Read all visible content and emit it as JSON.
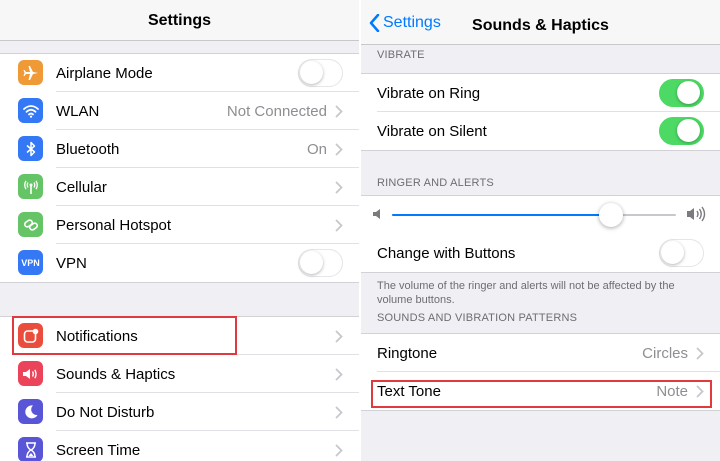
{
  "left": {
    "title": "Settings",
    "group1": [
      {
        "label": "Airplane Mode",
        "icon": "airplane-icon",
        "color": "#f09a37",
        "accessory": "toggle",
        "toggle_on": false
      },
      {
        "label": "WLAN",
        "icon": "wifi-icon",
        "color": "#3478f6",
        "accessory": "value",
        "value": "Not Connected"
      },
      {
        "label": "Bluetooth",
        "icon": "bluetooth-icon",
        "color": "#3478f6",
        "accessory": "value",
        "value": "On"
      },
      {
        "label": "Cellular",
        "icon": "cellular-icon",
        "color": "#65c466",
        "accessory": "chevron"
      },
      {
        "label": "Personal Hotspot",
        "icon": "hotspot-icon",
        "color": "#65c466",
        "accessory": "chevron"
      },
      {
        "label": "VPN",
        "icon": "vpn-icon",
        "icon_text": "VPN",
        "color": "#3478f6",
        "accessory": "toggle",
        "toggle_on": false
      }
    ],
    "group2": [
      {
        "label": "Notifications",
        "icon": "notifications-icon",
        "color": "#eb4d3d",
        "accessory": "chevron"
      },
      {
        "label": "Sounds & Haptics",
        "icon": "speaker-icon",
        "color": "#eb445a",
        "accessory": "chevron"
      },
      {
        "label": "Do Not Disturb",
        "icon": "moon-icon",
        "color": "#5856d6",
        "accessory": "chevron"
      },
      {
        "label": "Screen Time",
        "icon": "hourglass-icon",
        "color": "#5856d6",
        "accessory": "chevron"
      }
    ]
  },
  "right": {
    "back_label": "Settings",
    "title": "Sounds & Haptics",
    "vibrate_header": "VIBRATE",
    "vibrate_ring": {
      "label": "Vibrate on Ring",
      "toggle_on": true
    },
    "vibrate_silent": {
      "label": "Vibrate on Silent",
      "toggle_on": true
    },
    "ringer_header": "RINGER AND ALERTS",
    "ringer_volume": 0.77,
    "change_with_buttons": {
      "label": "Change with Buttons",
      "toggle_on": false
    },
    "ringer_note": "The volume of the ringer and alerts will not be affected by the volume buttons.",
    "patterns_header": "SOUNDS AND VIBRATION PATTERNS",
    "ringtone": {
      "label": "Ringtone",
      "value": "Circles"
    },
    "text_tone": {
      "label": "Text Tone",
      "value": "Note"
    }
  },
  "colors": {
    "accent": "#007aff",
    "toggle_on": "#4cd964",
    "highlight": "#e0393e"
  }
}
